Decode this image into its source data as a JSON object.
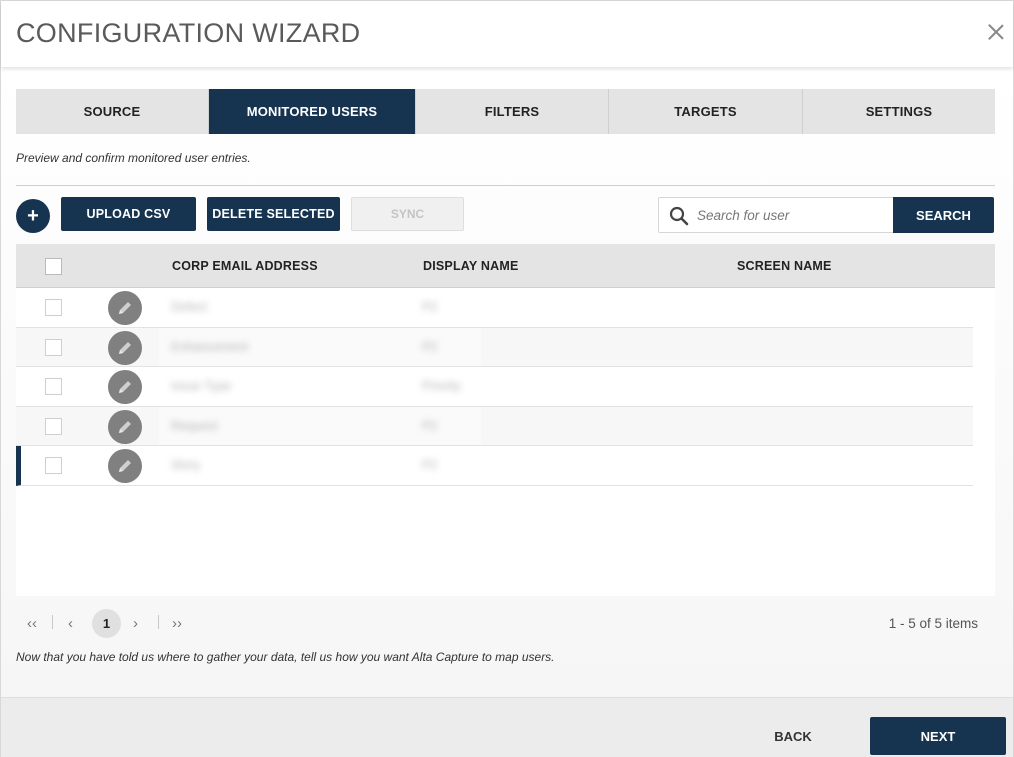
{
  "header": {
    "title": "CONFIGURATION WIZARD"
  },
  "tabs": [
    {
      "label": "SOURCE",
      "active": false
    },
    {
      "label": "MONITORED USERS",
      "active": true
    },
    {
      "label": "FILTERS",
      "active": false
    },
    {
      "label": "TARGETS",
      "active": false
    },
    {
      "label": "SETTINGS",
      "active": false
    }
  ],
  "intro_text": "Preview and confirm monitored user entries.",
  "toolbar": {
    "add_label": "+",
    "upload_label": "UPLOAD CSV",
    "delete_label": "DELETE SELECTED",
    "sync_label": "SYNC",
    "search_placeholder": "Search for user",
    "search_button": "SEARCH"
  },
  "grid": {
    "columns": [
      "CORP EMAIL ADDRESS",
      "DISPLAY NAME",
      "SCREEN NAME"
    ],
    "rows": [
      {
        "email": "Defect",
        "display": "P2",
        "screen": ""
      },
      {
        "email": "Enhancement",
        "display": "P2",
        "screen": ""
      },
      {
        "email": "Issue Type",
        "display": "Priority",
        "screen": ""
      },
      {
        "email": "Request",
        "display": "P2",
        "screen": ""
      },
      {
        "email": "Story",
        "display": "P2",
        "screen": ""
      }
    ]
  },
  "pager": {
    "first": "‹‹",
    "prev": "‹",
    "current_page": "1",
    "next": "›",
    "last": "››",
    "info": "1 - 5 of 5 items"
  },
  "footer_note": "Now that you have told us where to gather your data, tell us how you want Alta Capture to map users.",
  "footer": {
    "back_label": "BACK",
    "next_label": "NEXT"
  },
  "colors": {
    "primary": "#163350",
    "tab_bg": "#e4e4e4",
    "edit_icon_bg": "#808080"
  },
  "icons": {
    "close": "close-icon",
    "search": "search-icon",
    "edit": "pencil-icon"
  }
}
